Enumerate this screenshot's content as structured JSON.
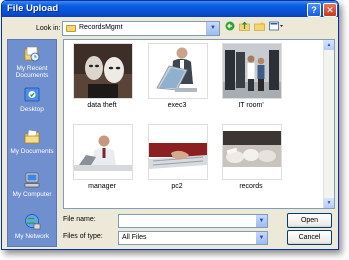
{
  "window": {
    "title": "File Upload",
    "help_glyph": "?",
    "close_glyph": "✕"
  },
  "lookin": {
    "label": "Look in:",
    "value": "RecordsMgmt"
  },
  "places": [
    {
      "label_1": "My Recent",
      "label_2": "Documents"
    },
    {
      "label_1": "Desktop",
      "label_2": ""
    },
    {
      "label_1": "My Documents",
      "label_2": ""
    },
    {
      "label_1": "My Computer",
      "label_2": ""
    },
    {
      "label_1": "My Network",
      "label_2": ""
    }
  ],
  "files": [
    {
      "name": "data theft",
      "icon": "masks-photo"
    },
    {
      "name": "exec3",
      "icon": "laptop-man-photo"
    },
    {
      "name": "IT room'",
      "icon": "server-room-photo"
    },
    {
      "name": "manager",
      "icon": "desk-man-photo"
    },
    {
      "name": "pc2",
      "icon": "keyboard-hand-photo"
    },
    {
      "name": "records",
      "icon": "paper-files-photo"
    }
  ],
  "filename": {
    "label": "File name:",
    "value": ""
  },
  "filetype": {
    "label": "Files of type:",
    "value": "All Files"
  },
  "buttons": {
    "open": "Open",
    "cancel": "Cancel"
  },
  "colors": {
    "titlebar": "#0a5bdc",
    "places_bar": "#6f8fce",
    "dialog_bg": "#ece9d8"
  }
}
